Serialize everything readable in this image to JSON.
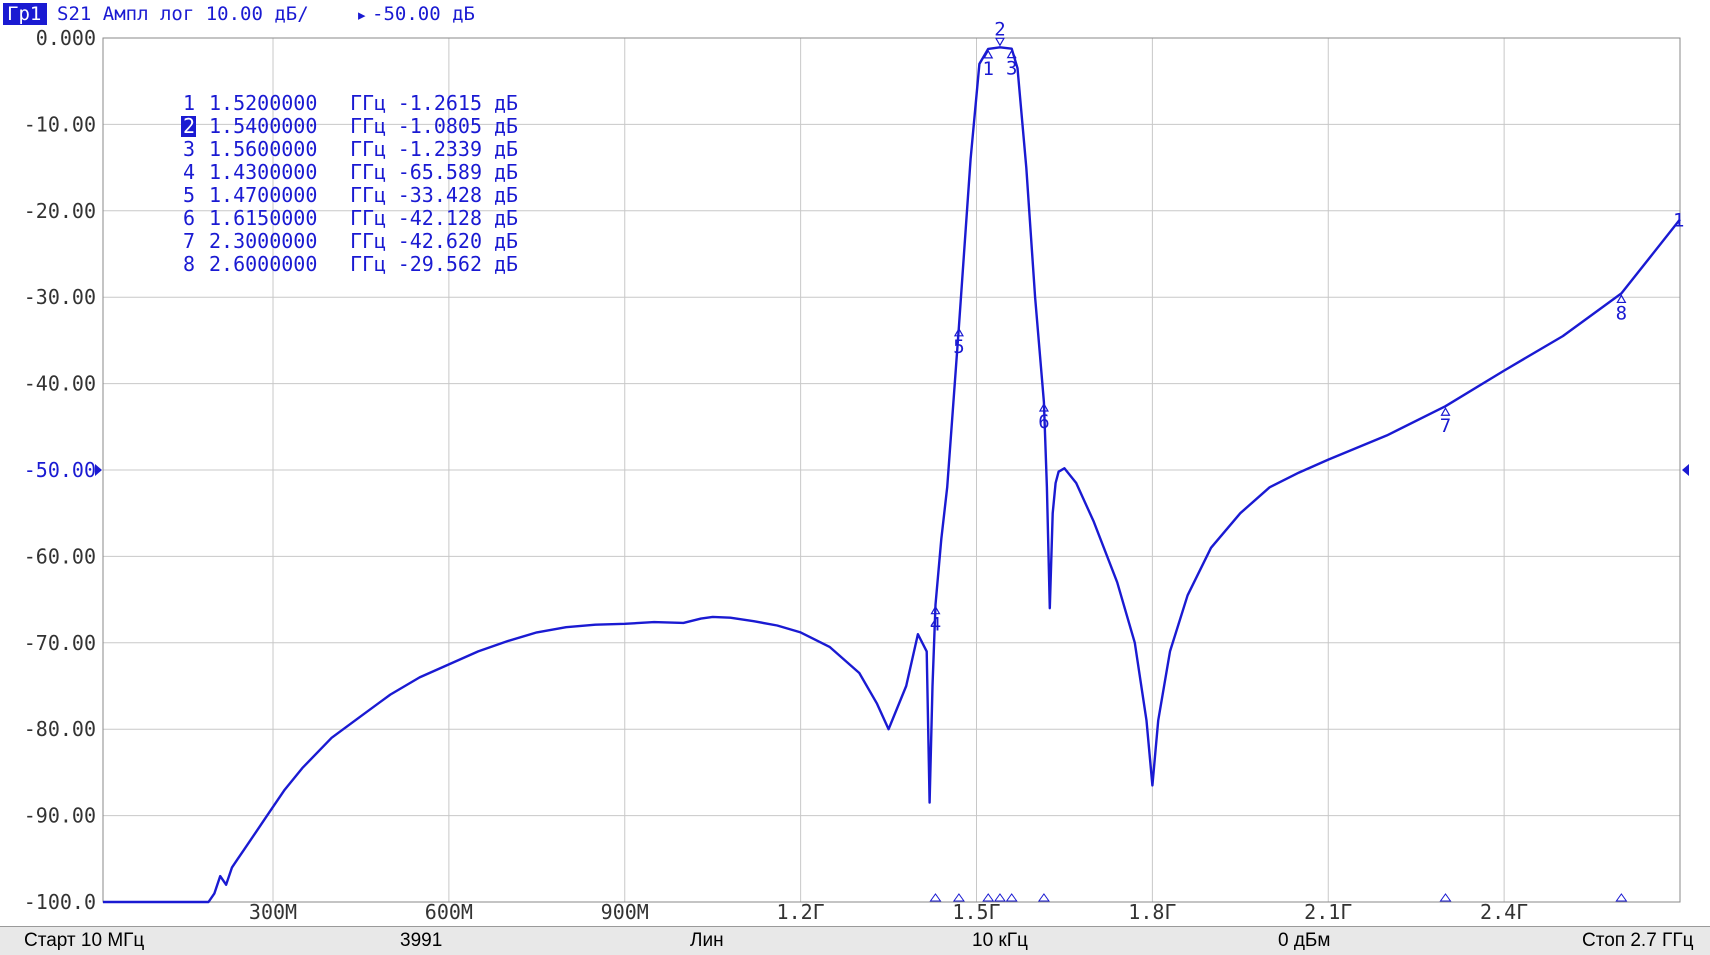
{
  "header": {
    "trace_tag": "Гр1",
    "trace_info": "S21 Ампл лог 10.00 дБ/",
    "ref_marker": "▸",
    "ref_text": "-50.00 дБ"
  },
  "colors": {
    "trace": "#1a1ad2",
    "marker": "#1a1ad2",
    "grid": "#c8c8c8",
    "axis_text": "#333333",
    "ref_text": "#1a1ad2",
    "tag_bg": "#1a1ad2",
    "statusbar_bg": "#e8e8e8"
  },
  "chart_data": {
    "type": "line",
    "xlim": [
      0.01,
      2.7
    ],
    "ylim": [
      -100,
      0
    ],
    "ref_level": -50,
    "grid": true,
    "y_ticks": [
      "0.000",
      "-10.00",
      "-20.00",
      "-30.00",
      "-40.00",
      "-50.00",
      "-60.00",
      "-70.00",
      "-80.00",
      "-90.00",
      "-100.0"
    ],
    "x_ticks": [
      {
        "value": 0.3,
        "label": "300М"
      },
      {
        "value": 0.6,
        "label": "600М"
      },
      {
        "value": 0.9,
        "label": "900М"
      },
      {
        "value": 1.2,
        "label": "1.2Г"
      },
      {
        "value": 1.5,
        "label": "1.5Г"
      },
      {
        "value": 1.8,
        "label": "1.8Г"
      },
      {
        "value": 2.1,
        "label": "2.1Г"
      },
      {
        "value": 2.4,
        "label": "2.4Г"
      }
    ],
    "series": [
      {
        "x": [
          0.01,
          0.19,
          0.2,
          0.21,
          0.22,
          0.23,
          0.24,
          0.25,
          0.27,
          0.29,
          0.32,
          0.35,
          0.4,
          0.45,
          0.5,
          0.55,
          0.6,
          0.65,
          0.7,
          0.75,
          0.8,
          0.85,
          0.9,
          0.95,
          1.0,
          1.03,
          1.05,
          1.08,
          1.12,
          1.16,
          1.2,
          1.25,
          1.3,
          1.33,
          1.35,
          1.38,
          1.4,
          1.415,
          1.42,
          1.425,
          1.43,
          1.44,
          1.45,
          1.47,
          1.49,
          1.505,
          1.52,
          1.54,
          1.56,
          1.57,
          1.585,
          1.6,
          1.615,
          1.62,
          1.625,
          1.63,
          1.635,
          1.64,
          1.65,
          1.67,
          1.7,
          1.74,
          1.77,
          1.79,
          1.8,
          1.81,
          1.83,
          1.86,
          1.9,
          1.95,
          2.0,
          2.05,
          2.1,
          2.2,
          2.3,
          2.4,
          2.5,
          2.6,
          2.7
        ],
        "y": [
          -100,
          -100,
          -99,
          -97,
          -98,
          -96,
          -95,
          -94,
          -92,
          -90,
          -87,
          -84.5,
          -81,
          -78.5,
          -76,
          -74,
          -72.5,
          -71,
          -69.8,
          -68.8,
          -68.2,
          -67.9,
          -67.8,
          -67.6,
          -67.7,
          -67.2,
          -67.0,
          -67.1,
          -67.5,
          -68.0,
          -68.8,
          -70.5,
          -73.5,
          -77.0,
          -80.0,
          -75.0,
          -69.0,
          -71.0,
          -88.5,
          -75.0,
          -65.589,
          -58.0,
          -52.0,
          -33.428,
          -14.0,
          -3.0,
          -1.2615,
          -1.0805,
          -1.2339,
          -3.5,
          -15.0,
          -30.0,
          -42.128,
          -52.0,
          -66.0,
          -55.0,
          -51.5,
          -50.2,
          -49.8,
          -51.5,
          -56.0,
          -63.0,
          -70.0,
          -79.0,
          -86.5,
          -79.0,
          -71.0,
          -64.5,
          -59.0,
          -55.0,
          -52.0,
          -50.3,
          -48.8,
          -46.0,
          -42.62,
          -38.5,
          -34.5,
          -29.562,
          -21.0
        ]
      }
    ],
    "markers": [
      {
        "n": "1",
        "x": 1.52,
        "y": -1.2615
      },
      {
        "n": "2",
        "x": 1.54,
        "y": -1.0805
      },
      {
        "n": "3",
        "x": 1.56,
        "y": -1.2339
      },
      {
        "n": "4",
        "x": 1.43,
        "y": -65.589
      },
      {
        "n": "5",
        "x": 1.47,
        "y": -33.428
      },
      {
        "n": "6",
        "x": 1.615,
        "y": -42.128
      },
      {
        "n": "7",
        "x": 2.3,
        "y": -42.62
      },
      {
        "n": "8",
        "x": 2.6,
        "y": -29.562
      }
    ],
    "marker_table": [
      {
        "n": "1",
        "freq": "1.5200000",
        "unit": "ГГц",
        "value": "-1.2615",
        "vunit": "дБ",
        "active": false
      },
      {
        "n": "2",
        "freq": "1.5400000",
        "unit": "ГГц",
        "value": "-1.0805",
        "vunit": "дБ",
        "active": true
      },
      {
        "n": "3",
        "freq": "1.5600000",
        "unit": "ГГц",
        "value": "-1.2339",
        "vunit": "дБ",
        "active": false
      },
      {
        "n": "4",
        "freq": "1.4300000",
        "unit": "ГГц",
        "value": "-65.589",
        "vunit": "дБ",
        "active": false
      },
      {
        "n": "5",
        "freq": "1.4700000",
        "unit": "ГГц",
        "value": "-33.428",
        "vunit": "дБ",
        "active": false
      },
      {
        "n": "6",
        "freq": "1.6150000",
        "unit": "ГГц",
        "value": "-42.128",
        "vunit": "дБ",
        "active": false
      },
      {
        "n": "7",
        "freq": "2.3000000",
        "unit": "ГГц",
        "value": "-42.620",
        "vunit": "дБ",
        "active": false
      },
      {
        "n": "8",
        "freq": "2.6000000",
        "unit": "ГГц",
        "value": "-29.562",
        "vunit": "дБ",
        "active": false
      }
    ],
    "trace_end_label": "1"
  },
  "statusbar": {
    "start": "Старт 10 МГц",
    "points": "3991",
    "sweep": "Лин",
    "ifbw": "10 кГц",
    "power": "0 дБм",
    "stop": "Стоп 2.7 ГГц"
  }
}
